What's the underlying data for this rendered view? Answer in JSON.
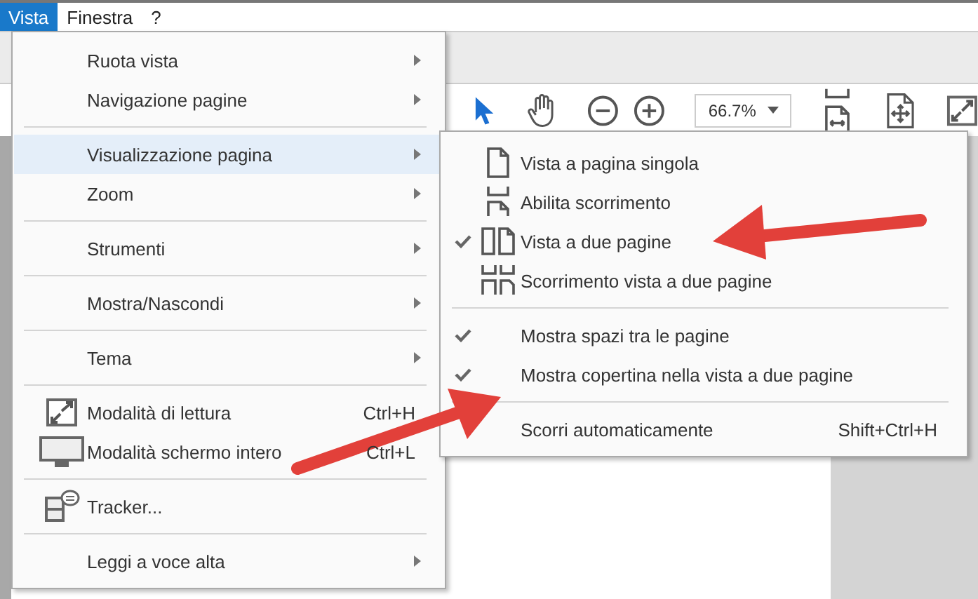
{
  "menubar": [
    {
      "label": "Vista",
      "selected": true
    },
    {
      "label": "Finestra",
      "selected": false
    },
    {
      "label": "?",
      "selected": false
    }
  ],
  "toolbar": {
    "zoom_field": {
      "value": "66.7%"
    }
  },
  "menu": {
    "items": [
      {
        "kind": "item",
        "label": "Ruota vista",
        "submenu": true,
        "selected": false
      },
      {
        "kind": "item",
        "label": "Navigazione pagine",
        "submenu": true,
        "selected": false
      },
      {
        "kind": "separator"
      },
      {
        "kind": "item",
        "label": "Visualizzazione pagina",
        "submenu": true,
        "selected": true
      },
      {
        "kind": "item",
        "label": "Zoom",
        "submenu": true,
        "selected": false
      },
      {
        "kind": "separator"
      },
      {
        "kind": "item",
        "label": "Strumenti",
        "submenu": true,
        "selected": false
      },
      {
        "kind": "separator"
      },
      {
        "kind": "item",
        "label": "Mostra/Nascondi",
        "submenu": true,
        "selected": false
      },
      {
        "kind": "separator"
      },
      {
        "kind": "item",
        "label": "Tema",
        "submenu": true,
        "selected": false
      },
      {
        "kind": "separator"
      },
      {
        "kind": "item",
        "label": "Modalità di lettura",
        "shortcut": "Ctrl+H",
        "selected": false
      },
      {
        "kind": "item",
        "label": "Modalità schermo intero",
        "shortcut": "Ctrl+L",
        "selected": false
      },
      {
        "kind": "separator"
      },
      {
        "kind": "item",
        "label": "Tracker...",
        "selected": false
      },
      {
        "kind": "separator"
      },
      {
        "kind": "item",
        "label": "Leggi a voce alta",
        "submenu": true,
        "selected": false
      }
    ]
  },
  "submenu": {
    "items": [
      {
        "kind": "item",
        "label": "Vista a pagina singola",
        "checked": false
      },
      {
        "kind": "item",
        "label": "Abilita scorrimento",
        "checked": false
      },
      {
        "kind": "item",
        "label": "Vista a due pagine",
        "checked": true
      },
      {
        "kind": "item",
        "label": "Scorrimento vista a due pagine",
        "checked": false
      },
      {
        "kind": "separator"
      },
      {
        "kind": "item",
        "label": "Mostra spazi tra le pagine",
        "checked": true
      },
      {
        "kind": "item",
        "label": "Mostra copertina nella vista a due pagine",
        "checked": true
      },
      {
        "kind": "separator"
      },
      {
        "kind": "item",
        "label": "Scorri automaticamente",
        "shortcut": "Shift+Ctrl+H",
        "checked": false
      }
    ]
  }
}
